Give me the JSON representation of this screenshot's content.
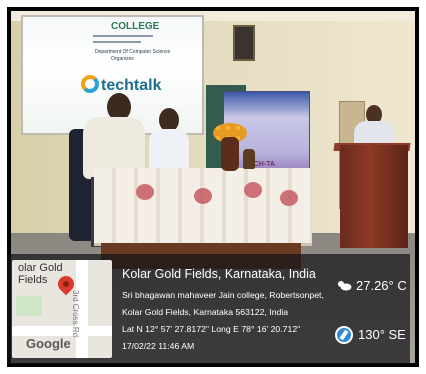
{
  "photo": {
    "screen_title": "COLLEGE",
    "screen_sub1": "Department Of Computer Science",
    "screen_sub2": "Organizes",
    "screen_logo_text": "techtalk",
    "banner_text": "ECH-TA"
  },
  "gps": {
    "map_town": "olar Gold\nFields",
    "map_road": "3rd Cross Rd",
    "map_brand": "Google",
    "location_title": "Kolar Gold Fields, Karnataka, India",
    "address_line1": "Sri bhagawan mahaveer Jain college, Robertsonpet,",
    "address_line2": "Kolar Gold Fields, Karnataka 563122, India",
    "coordinates": "Lat N 12° 57' 27.8172\" Long E 78° 16' 20.712\"",
    "datetime": "17/02/22 11:46 AM",
    "temperature": "27.26° C",
    "heading": "130° SE",
    "weather_icon": "partly-cloudy-icon",
    "compass_icon": "compass-icon"
  }
}
